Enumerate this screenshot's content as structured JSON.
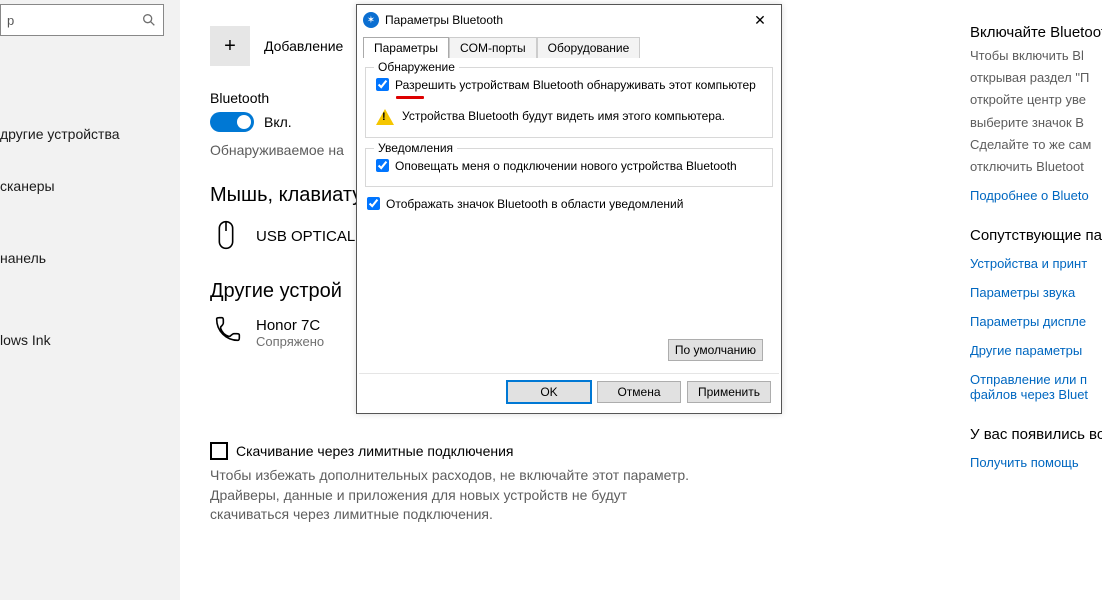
{
  "sidebar": {
    "search_placeholder": "p",
    "items": [
      "другие устройства",
      "сканеры",
      "нанель",
      "lows Ink"
    ]
  },
  "main": {
    "add_label": "Добавление",
    "bt_label": "Bluetooth",
    "toggle_on": "Вкл.",
    "discoverable": "Обнаруживаемое на",
    "mouse_heading": "Мышь, клавиату",
    "mouse_device": "USB OPTICAL",
    "other_heading": "Другие устрой",
    "honor_title": "Honor 7C",
    "honor_sub": "Сопряжено",
    "metered_title": "Скачивание через лимитные подключения",
    "metered_desc": "Чтобы избежать дополнительных расходов, не включайте этот параметр. Драйверы, данные и приложения для новых устройств не будут скачиваться через лимитные подключения."
  },
  "dialog": {
    "title": "Параметры Bluetooth",
    "tabs": [
      "Параметры",
      "COM-порты",
      "Оборудование"
    ],
    "group_discovery": "Обнаружение",
    "cb_discovery": "Разрешить устройствам Bluetooth обнаруживать этот компьютер",
    "warn_text": "Устройства Bluetooth будут видеть имя этого компьютера.",
    "group_notify": "Уведомления",
    "cb_notify": "Оповещать меня о подключении нового устройства Bluetooth",
    "cb_tray": "Отображать значок Bluetooth в области уведомлений",
    "defaults_btn": "По умолчанию",
    "ok_btn": "OK",
    "cancel_btn": "Отмена",
    "apply_btn": "Применить"
  },
  "right": {
    "head1": "Включайте Bluetoot",
    "body_lines": [
      "Чтобы включить Bl",
      "открывая раздел \"П",
      "откройте центр уве",
      "выберите значок B",
      "Сделайте то же сам",
      "отключить Bluetoot"
    ],
    "link1": "Подробнее о Blueto",
    "head2": "Сопутствующие пар",
    "links2": [
      "Устройства и принт",
      "Параметры звука",
      "Параметры диспле",
      "Другие параметры",
      "Отправление или п файлов через Bluet"
    ],
    "head3": "У вас появились во",
    "link3": "Получить помощь"
  }
}
